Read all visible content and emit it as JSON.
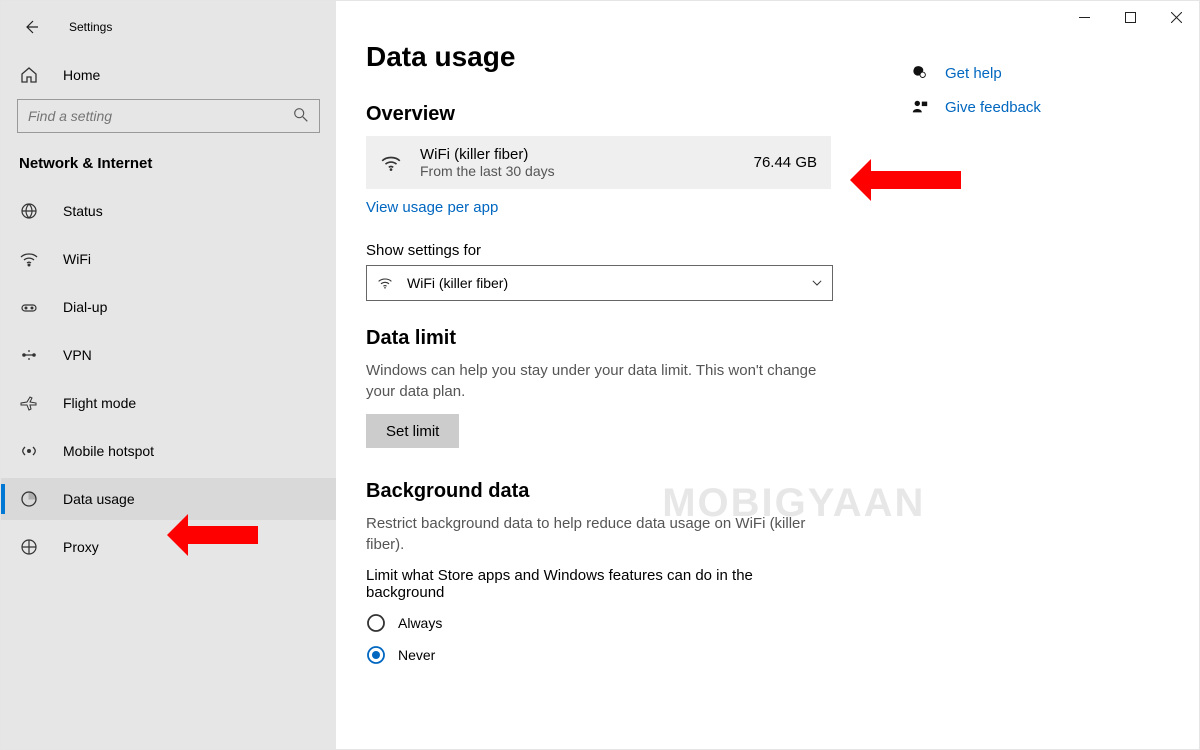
{
  "window": {
    "title": "Settings"
  },
  "sidebar": {
    "home_label": "Home",
    "search_placeholder": "Find a setting",
    "section_label": "Network & Internet",
    "items": [
      {
        "label": "Status"
      },
      {
        "label": "WiFi"
      },
      {
        "label": "Dial-up"
      },
      {
        "label": "VPN"
      },
      {
        "label": "Flight mode"
      },
      {
        "label": "Mobile hotspot"
      },
      {
        "label": "Data usage"
      },
      {
        "label": "Proxy"
      }
    ]
  },
  "main": {
    "page_title": "Data usage",
    "overview_heading": "Overview",
    "overview": {
      "network_name": "WiFi (killer fiber)",
      "period": "From the last 30 days",
      "amount": "76.44 GB"
    },
    "view_per_app_link": "View usage per app",
    "show_settings_label": "Show settings for",
    "dropdown_value": "WiFi (killer fiber)",
    "data_limit_heading": "Data limit",
    "data_limit_desc": "Windows can help you stay under your data limit. This won't change your data plan.",
    "set_limit_btn": "Set limit",
    "background_heading": "Background data",
    "background_desc": "Restrict background data to help reduce data usage on WiFi (killer fiber).",
    "background_question": "Limit what Store apps and Windows features can do in the background",
    "radio_always": "Always",
    "radio_never": "Never"
  },
  "help": {
    "get_help": "Get help",
    "give_feedback": "Give feedback"
  },
  "watermark": "MOBIGYAAN"
}
